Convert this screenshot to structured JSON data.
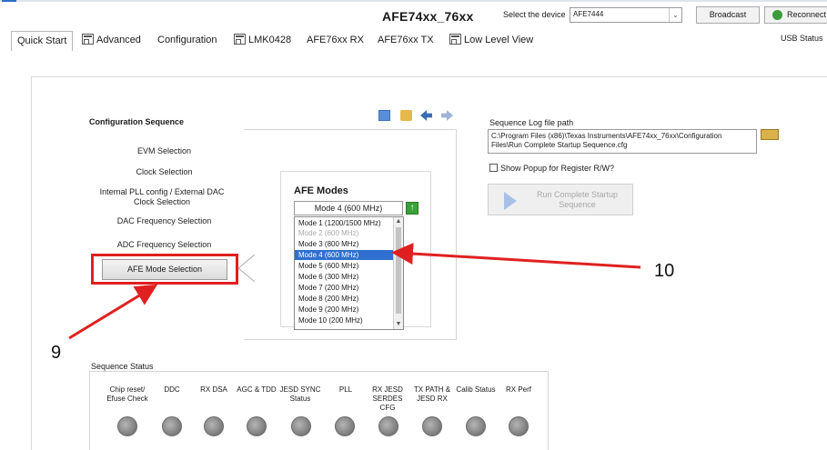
{
  "window": {
    "title": "AFE74xx_76xx",
    "device_label": "Select the device",
    "device_value": "AFE7444",
    "broadcast_label": "Broadcast",
    "reconnect_label": "Reconnect"
  },
  "tabs": [
    {
      "label": "Quick Start",
      "active": true
    },
    {
      "label": "Advanced"
    },
    {
      "label": "Configuration"
    },
    {
      "label": "LMK0428"
    },
    {
      "label": "AFE76xx RX"
    },
    {
      "label": "AFE76xx TX"
    },
    {
      "label": "Low Level View"
    }
  ],
  "tab_status": "USB Status",
  "config_sequence": {
    "title": "Configuration Sequence",
    "items": [
      "EVM Selection",
      "Clock Selection",
      "Internal PLL config / External DAC Clock Selection",
      "DAC Frequency Selection",
      "ADC Frequency Selection"
    ],
    "afe_mode_button": "AFE Mode Selection"
  },
  "afe_modes": {
    "title": "AFE Modes",
    "selected": "Mode 4 (600 MHz)",
    "options": [
      {
        "label": "Mode 1 (1200/1500 MHz)",
        "state": "normal"
      },
      {
        "label": "Mode 2 (600 MHz)",
        "state": "disabled"
      },
      {
        "label": "Mode 3 (800 MHz)",
        "state": "normal"
      },
      {
        "label": "Mode 4 (600 MHz)",
        "state": "selected"
      },
      {
        "label": "Mode 5 (600 MHz)",
        "state": "normal"
      },
      {
        "label": "Mode 6 (300 MHz)",
        "state": "normal"
      },
      {
        "label": "Mode 7 (200 MHz)",
        "state": "normal"
      },
      {
        "label": "Mode 8 (200 MHz)",
        "state": "normal"
      },
      {
        "label": "Mode 9 (200 MHz)",
        "state": "normal"
      },
      {
        "label": "Mode 10 (200 MHz)",
        "state": "normal"
      }
    ]
  },
  "sequence_log": {
    "label": "Sequence Log file path",
    "path": "C:\\Program Files (x86)\\Texas Instruments\\AFE74xx_76xx\\Configuration Files\\Run Complete Startup Sequence.cfg",
    "show_popup_label": "Show Popup for Register R/W?",
    "run_label": "Run Complete Startup Sequence"
  },
  "sequence_status": {
    "label": "Sequence Status",
    "items": [
      "Chip reset/ Efuse Check",
      "DDC",
      "RX DSA",
      "AGC & TDD",
      "JESD SYNC Status",
      "PLL",
      "RX JESD SERDES CFG",
      "TX PATH & JESD RX",
      "Calib Status",
      "RX Perf"
    ]
  },
  "annotations": {
    "callout_9": "9",
    "callout_10": "10",
    "arrow_color": "#e02020"
  }
}
